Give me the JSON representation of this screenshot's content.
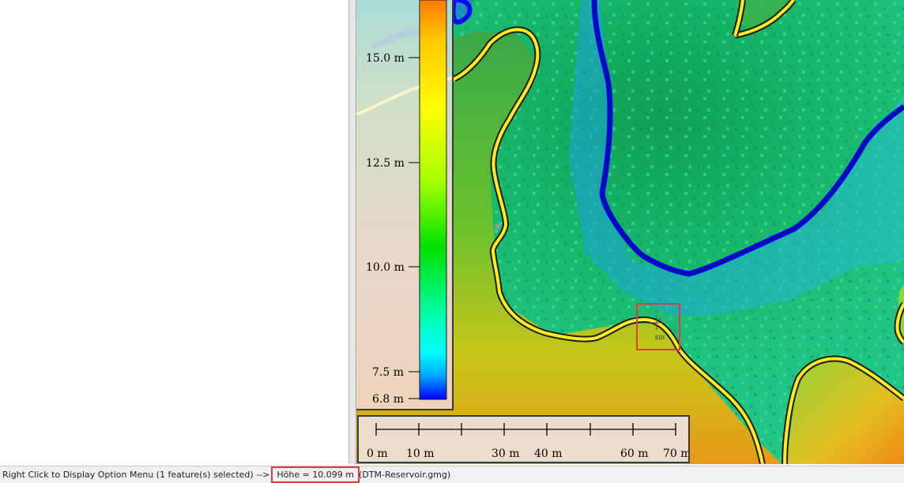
{
  "status_bar": {
    "message": "Right Click to Display Option Menu (1 feature(s) selected) -->",
    "height_readout": "Höhe = 10.099 m",
    "file": "(DTM-Reservoir.gmg)"
  },
  "legend": {
    "labels": [
      "15.0 m",
      "12.5 m",
      "10.0 m",
      "7.5 m",
      "6.8 m"
    ],
    "gradient_colors": [
      "#ff7a00",
      "#ffc800",
      "#ffff00",
      "#a8ff00",
      "#00e000",
      "#00ffb4",
      "#00ffff",
      "#00a8ff",
      "#0000ff"
    ]
  },
  "scale_bar": {
    "labels": [
      "0 m",
      "10 m",
      "30 m",
      "40 m",
      "60 m",
      "70 m"
    ]
  },
  "map": {
    "cursor_label": "EDI",
    "colors": {
      "contour": "#ffec1a",
      "contour_edge": "#1c1c1c",
      "water_line": "#1a3cff",
      "selection_box": "#e03c3c"
    }
  }
}
